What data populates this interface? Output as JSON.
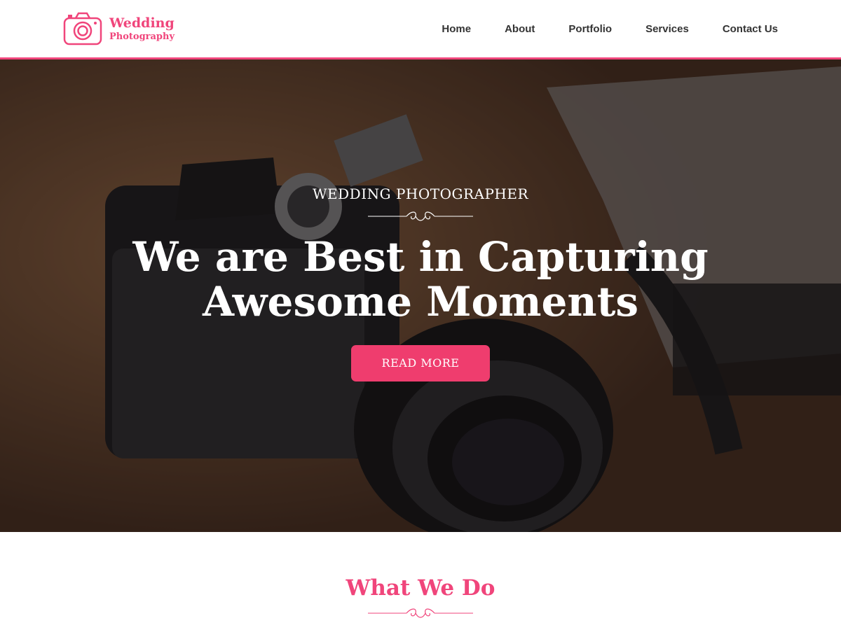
{
  "brand": {
    "line1": "Wedding",
    "line2": "Photography",
    "accent": "#f0457b",
    "icon": "camera-icon"
  },
  "nav": {
    "items": [
      "Home",
      "About",
      "Portfolio",
      "Services",
      "Contact Us"
    ]
  },
  "hero": {
    "subtitle": "WEDDING PHOTOGRAPHER",
    "title_line1": "We are Best in Capturing",
    "title_line2": "Awesome Moments",
    "button": "READ MORE",
    "button_color": "#ef3d6e"
  },
  "section": {
    "title": "What We Do"
  }
}
